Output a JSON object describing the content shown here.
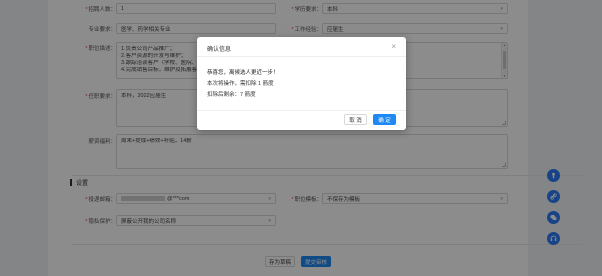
{
  "form": {
    "recruit_count": {
      "label": "招聘人数：",
      "value": "1"
    },
    "education": {
      "label": "学历要求：",
      "value": "本科"
    },
    "major": {
      "label": "专业要求：",
      "value": "医学、药学相关专业"
    },
    "experience": {
      "label": "工作经验：",
      "value": "应届生"
    },
    "duties": {
      "label": "职位描述：",
      "lines": [
        "1.负责公司产品推广；",
        "2.客户资源的开发与维护；",
        "3.跟踪洽谈客户（学校、医院、药...",
        "4.完成销售目标，维护及拓展客户..."
      ]
    },
    "requirements": {
      "label": "任职要求：",
      "value": "本科，2022应届生"
    },
    "benefits": {
      "label": "薪资福利：",
      "value": "周末+提成+绩效+补贴，14薪"
    }
  },
  "settings": {
    "section_title": "设置",
    "resume_email": {
      "label": "投递邮箱：",
      "value": "@***com"
    },
    "job_category": {
      "label": "职位模板：",
      "value": "不保存为模板"
    },
    "privacy": {
      "label": "隐私保护：",
      "value": "屏蔽公开我的公司名称"
    }
  },
  "buttons": {
    "save_draft": "存为草稿",
    "submit": "提交审核"
  },
  "modal": {
    "title": "确认信息",
    "line1": "恭喜您，离候选人更近一步！",
    "line2": "本次将操作，需扣除 1 箭度",
    "line3": "扣除后剩余：7 箭度",
    "cancel": "取 消",
    "confirm": "确 定"
  },
  "fab_icons": [
    "share-icon",
    "link-icon",
    "wechat-icon",
    "headset-icon"
  ],
  "colors": {
    "primary": "#1e89f3",
    "overlay": "rgba(0,0,0,0.45)",
    "required": "#e4393c"
  }
}
